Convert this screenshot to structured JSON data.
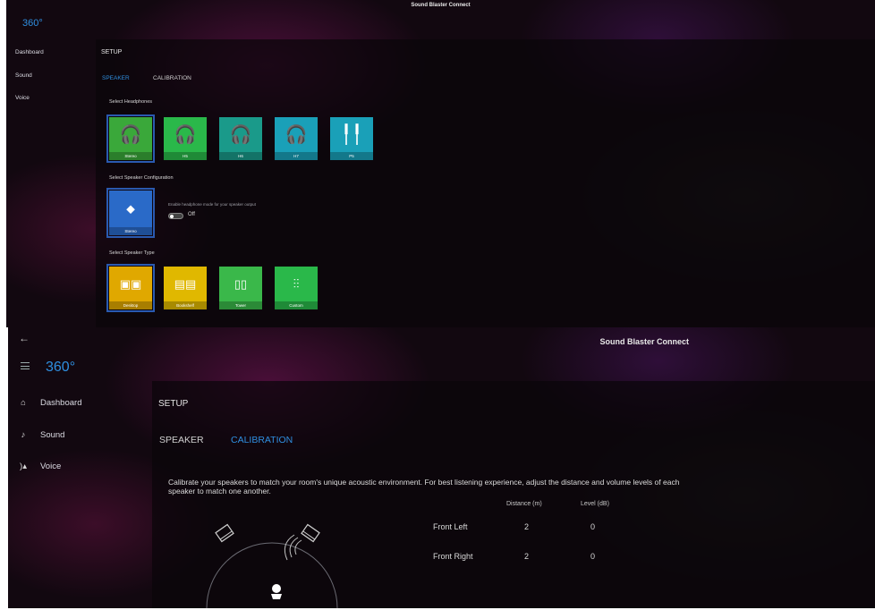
{
  "app_title": "Sound Blaster Connect",
  "logo_text": "360°",
  "nav": [
    {
      "label": "Dashboard",
      "icon": "home-icon"
    },
    {
      "label": "Sound",
      "icon": "music-note-icon"
    },
    {
      "label": "Voice",
      "icon": "voice-icon"
    }
  ],
  "section_title": "SETUP",
  "tabs": {
    "speaker": "SPEAKER",
    "calibration": "CALIBRATION"
  },
  "speaker_tab": {
    "select_headphones": "Select Headphones",
    "headphones": [
      {
        "label": "Stereo",
        "color": "#3aa83a",
        "selected": true
      },
      {
        "label": "H5",
        "color": "#2ab84a"
      },
      {
        "label": "H6",
        "color": "#1a9a8a"
      },
      {
        "label": "H7",
        "color": "#1aa0b8"
      },
      {
        "label": "P5",
        "color": "#1aa0b8"
      }
    ],
    "select_speaker_config": "Select Speaker Configuration",
    "speaker_config": {
      "label": "Stereo",
      "color": "#2a6ac8",
      "selected": true
    },
    "headphone_mode_desc": "Enable headphone mode for your speaker output",
    "toggle_state": "Off",
    "select_speaker_type": "Select Speaker Type",
    "speaker_types": [
      {
        "label": "Desktop",
        "color": "#e0a800",
        "selected": true
      },
      {
        "label": "Bookshelf",
        "color": "#e0b800"
      },
      {
        "label": "Tower",
        "color": "#3ab84a"
      },
      {
        "label": "Custom",
        "color": "#2ab84a"
      }
    ]
  },
  "calibration_tab": {
    "description": "Calibrate your speakers to match your room's unique acoustic environment. For best listening experience, adjust the distance and volume levels of each speaker to match one another.",
    "col_distance": "Distance (m)",
    "col_level": "Level (dB)",
    "rows": [
      {
        "label": "Front Left",
        "distance": "2",
        "level": "0"
      },
      {
        "label": "Front Right",
        "distance": "2",
        "level": "0"
      }
    ]
  },
  "colors": {
    "accent": "#2f8fe0"
  }
}
